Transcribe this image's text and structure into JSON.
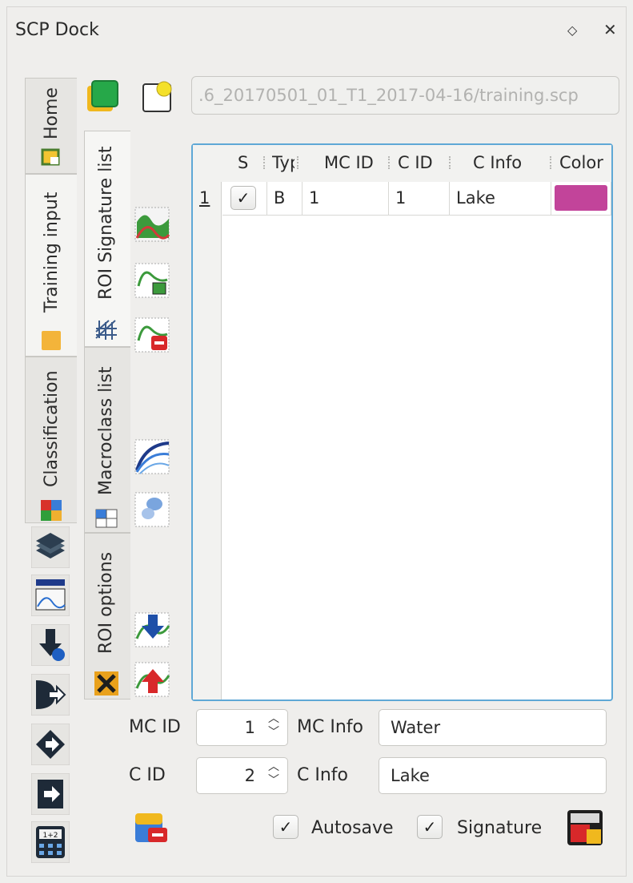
{
  "window": {
    "title": "SCP Dock",
    "float_icon": "diamond-icon",
    "close_icon": "close-icon"
  },
  "outer_tabs": [
    {
      "label": "Home",
      "icon": "home-tab-icon"
    },
    {
      "label": "Training input",
      "icon": "training-input-tab-icon"
    },
    {
      "label": "Classification",
      "icon": "classification-tab-icon"
    }
  ],
  "toolbar": {
    "project_path": ".6_20170501_01_T1_2017-04-16/training.scp"
  },
  "inner_tabs": [
    {
      "label": "ROI Signature list",
      "icon": "signature-list-icon"
    },
    {
      "label": "Macroclass list",
      "icon": "macroclass-list-icon"
    },
    {
      "label": "ROI options",
      "icon": "roi-options-icon"
    }
  ],
  "table": {
    "headers": [
      "S",
      "Type",
      "MC ID",
      "C ID",
      "C Info",
      "Color"
    ],
    "header_visible": [
      "S",
      "Type",
      "MC ID",
      "C ID",
      "C Info",
      "Color"
    ],
    "rows": [
      {
        "num": "1",
        "checked": "✓",
        "type": "B",
        "mc_id": "1",
        "c_id": "1",
        "c_info": "Lake",
        "color": "#c2449a"
      }
    ]
  },
  "form": {
    "mc_id_label": "MC ID",
    "mc_id_value": "1",
    "mc_info_label": "MC Info",
    "mc_info_value": "Water",
    "c_id_label": "C ID",
    "c_id_value": "2",
    "c_info_label": "C Info",
    "c_info_value": "Lake"
  },
  "bottom": {
    "autosave_label": "Autosave",
    "autosave_check": "✓",
    "signature_label": "Signature",
    "signature_check": "✓"
  },
  "colors": {
    "accent_border": "#5fa8d6",
    "class_color": "#c2449a"
  }
}
